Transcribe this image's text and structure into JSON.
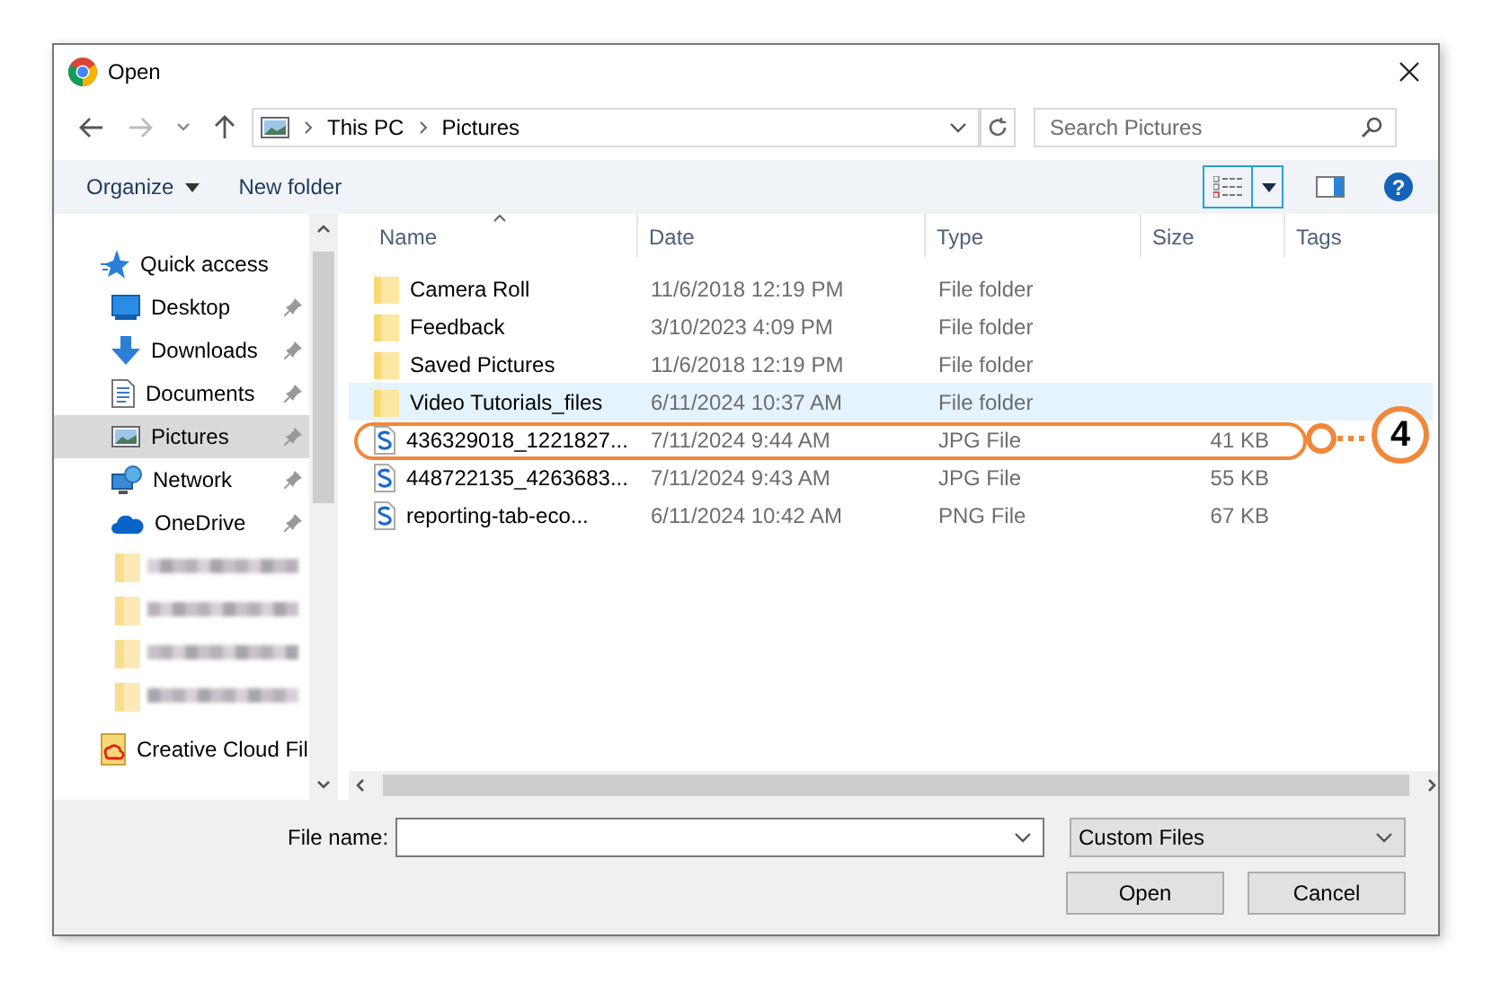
{
  "window": {
    "title": "Open"
  },
  "address": {
    "path": [
      "This PC",
      "Pictures"
    ]
  },
  "search": {
    "placeholder": "Search Pictures"
  },
  "toolbar": {
    "organize": "Organize",
    "new_folder": "New folder",
    "help": "?"
  },
  "sidebar": {
    "items": [
      {
        "label": "Quick access",
        "kind": "quick",
        "pinned": false,
        "selected": false
      },
      {
        "label": "Desktop",
        "kind": "desktop",
        "pinned": true,
        "selected": false
      },
      {
        "label": "Downloads",
        "kind": "downloads",
        "pinned": true,
        "selected": false
      },
      {
        "label": "Documents",
        "kind": "documents",
        "pinned": true,
        "selected": false
      },
      {
        "label": "Pictures",
        "kind": "pictures",
        "pinned": true,
        "selected": true
      },
      {
        "label": "Network",
        "kind": "network",
        "pinned": true,
        "selected": false
      },
      {
        "label": "OneDrive",
        "kind": "onedrive",
        "pinned": true,
        "selected": false
      },
      {
        "kind": "blurred"
      },
      {
        "kind": "blurred"
      },
      {
        "kind": "blurred"
      },
      {
        "kind": "blurred"
      },
      {
        "label": "Creative Cloud Fil",
        "kind": "creative",
        "pinned": false,
        "selected": false
      }
    ]
  },
  "table": {
    "columns": [
      "Name",
      "Date",
      "Type",
      "Size",
      "Tags"
    ],
    "rows": [
      {
        "name": "Camera Roll",
        "date": "11/6/2018 12:19 PM",
        "type": "File folder",
        "size": "",
        "kind": "folder",
        "selected": false,
        "outlined": false
      },
      {
        "name": "Feedback",
        "date": "3/10/2023 4:09 PM",
        "type": "File folder",
        "size": "",
        "kind": "folder",
        "selected": false,
        "outlined": false
      },
      {
        "name": "Saved Pictures",
        "date": "11/6/2018 12:19 PM",
        "type": "File folder",
        "size": "",
        "kind": "folder",
        "selected": false,
        "outlined": false
      },
      {
        "name": "Video Tutorials_files",
        "date": "6/11/2024 10:37 AM",
        "type": "File folder",
        "size": "",
        "kind": "folder",
        "selected": true,
        "outlined": false
      },
      {
        "name": "436329018_1221827...",
        "date": "7/11/2024 9:44 AM",
        "type": "JPG File",
        "size": "41 KB",
        "kind": "file",
        "selected": false,
        "outlined": true
      },
      {
        "name": "448722135_4263683...",
        "date": "7/11/2024 9:43 AM",
        "type": "JPG File",
        "size": "55 KB",
        "kind": "file",
        "selected": false,
        "outlined": false
      },
      {
        "name": "reporting-tab-eco...",
        "date": "6/11/2024 10:42 AM",
        "type": "PNG File",
        "size": "67 KB",
        "kind": "file",
        "selected": false,
        "outlined": false
      }
    ]
  },
  "callout": {
    "number": "4"
  },
  "footer": {
    "file_name_label": "File name:",
    "filter": "Custom Files",
    "buttons": [
      "Open",
      "Cancel"
    ]
  }
}
